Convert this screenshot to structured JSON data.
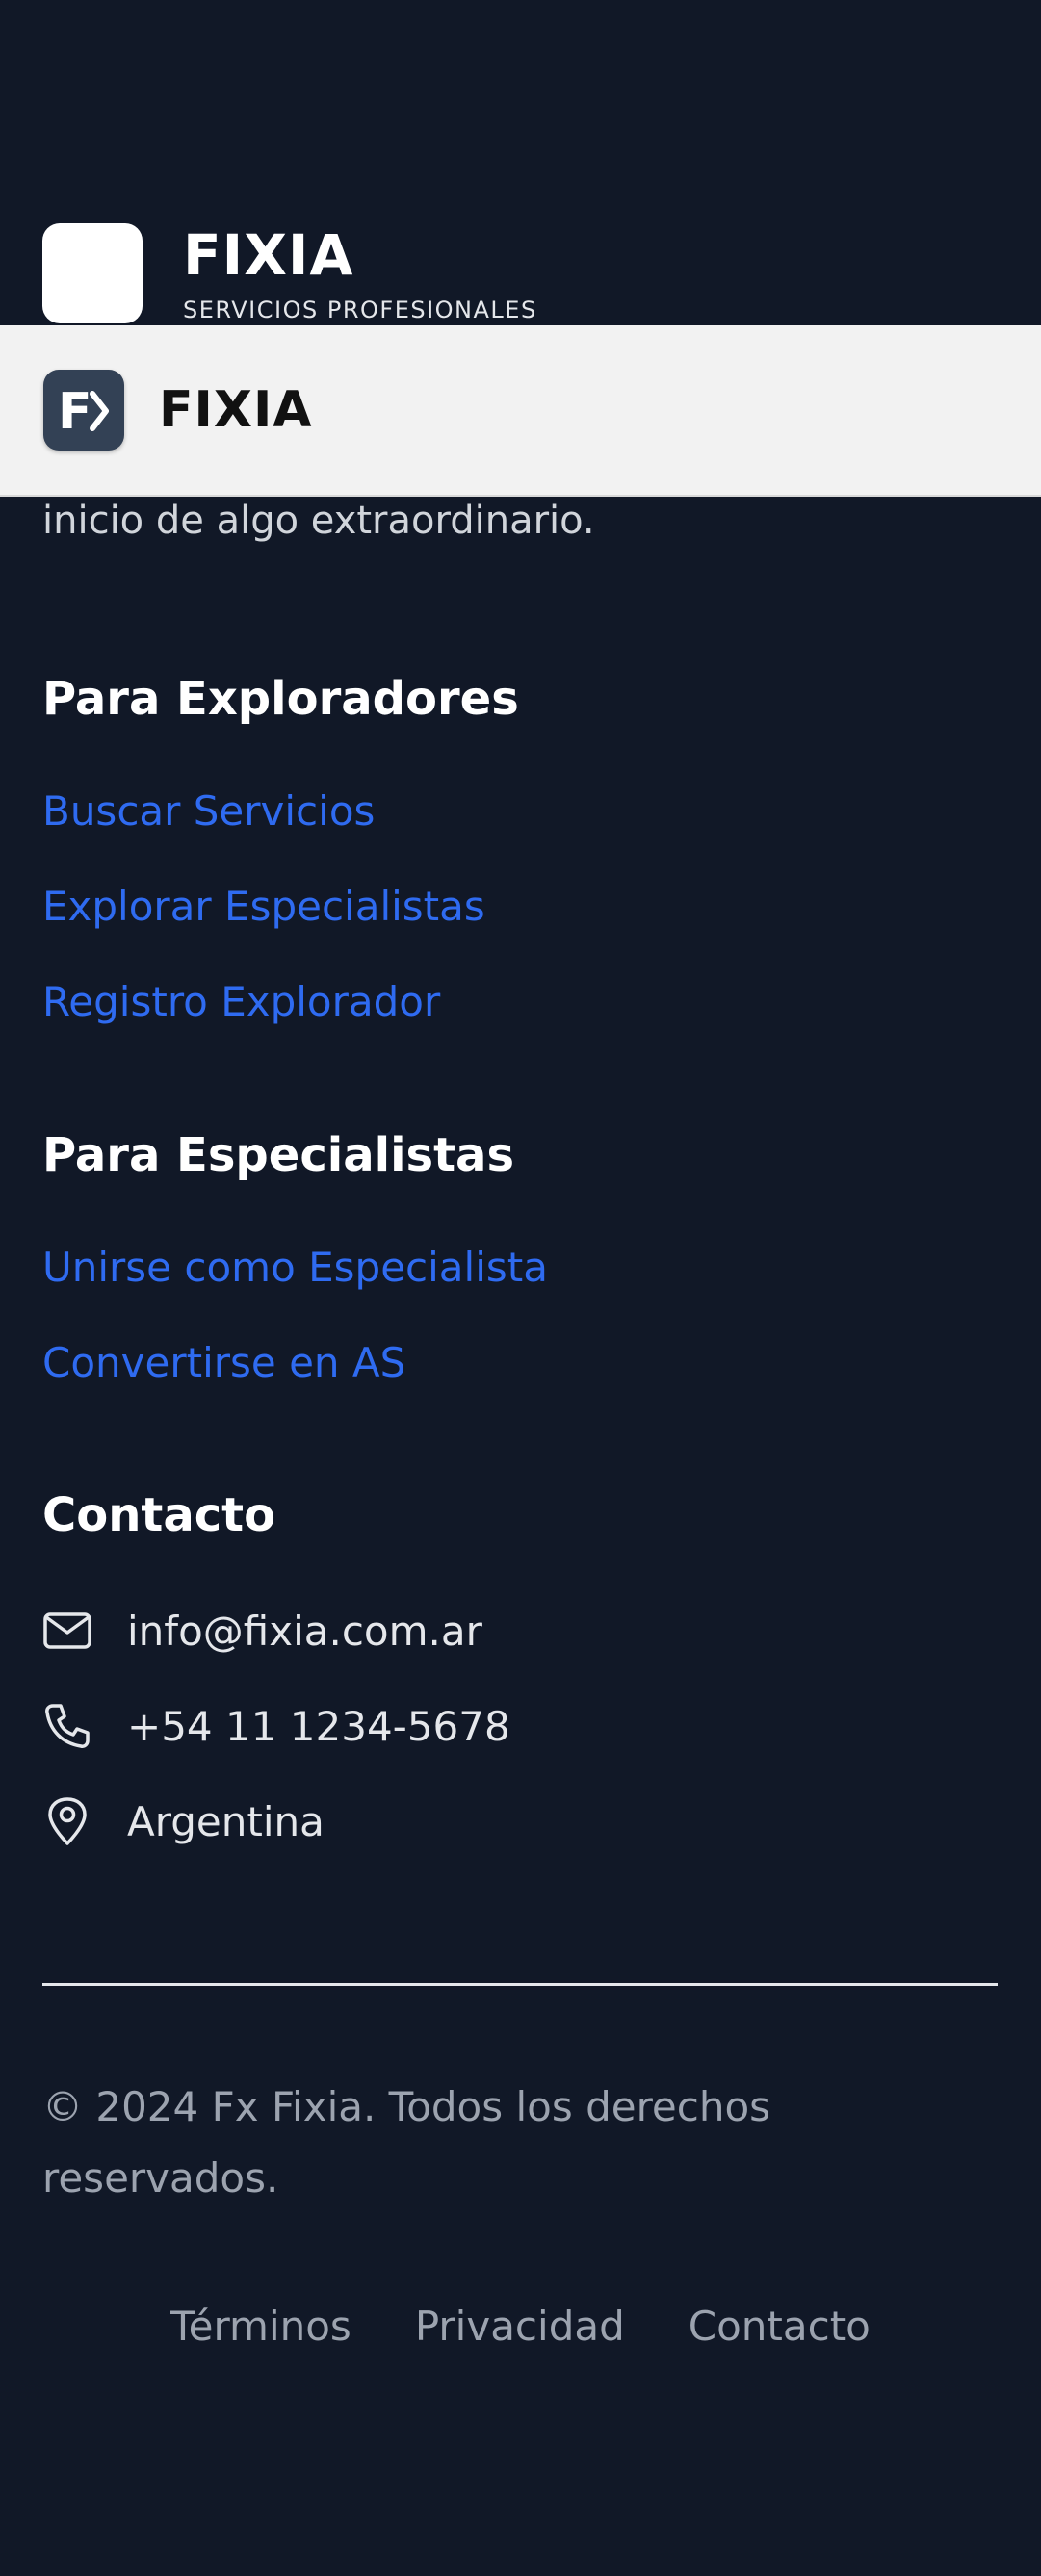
{
  "footer_brand": {
    "name": "FIXIA",
    "tagline": "SERVICIOS PROFESIONALES"
  },
  "footer_description": {
    "visible_line": "inicio de algo extraordinario."
  },
  "sticky_header": {
    "logo_text": "F",
    "brand_name": "FIXIA"
  },
  "explorers": {
    "title": "Para Exploradores",
    "links": [
      "Buscar Servicios",
      "Explorar Especialistas",
      "Registro Explorador"
    ]
  },
  "specialists": {
    "title": "Para Especialistas",
    "links": [
      "Unirse como Especialista",
      "Convertirse en AS"
    ]
  },
  "contact": {
    "title": "Contacto",
    "items": [
      {
        "icon": "mail-icon",
        "text": "info@fixia.com.ar"
      },
      {
        "icon": "phone-icon",
        "text": "+54 11 1234-5678"
      },
      {
        "icon": "map-pin-icon",
        "text": "Argentina"
      }
    ]
  },
  "copyright": "© 2024 Fx Fixia. Todos los derechos reservados.",
  "bottom_links": [
    "Términos",
    "Privacidad",
    "Contacto"
  ],
  "colors": {
    "background": "#111827",
    "link": "#2f6bf1",
    "muted": "#9ca3af",
    "header_bg": "#f2f2f2",
    "logo_bg": "#334155"
  }
}
